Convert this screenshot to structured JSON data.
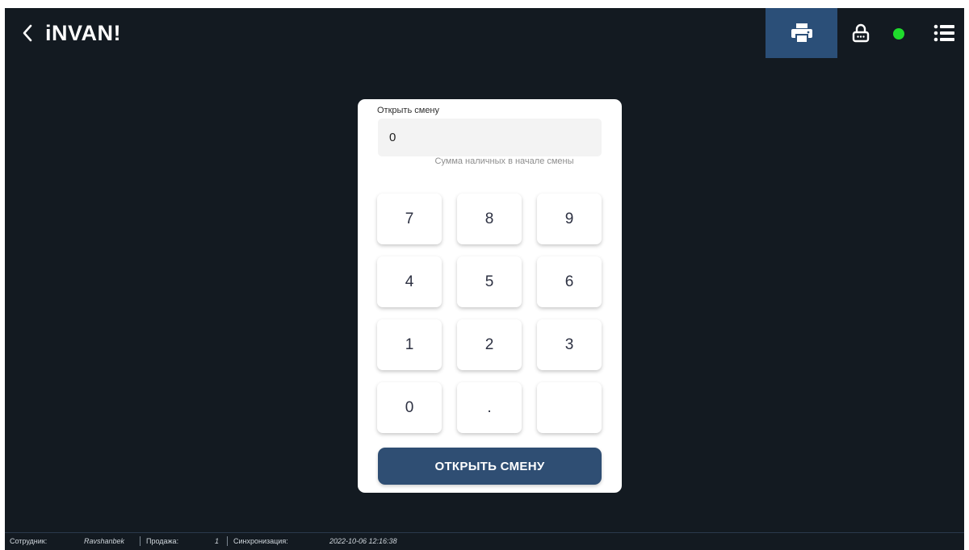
{
  "header": {
    "logo": "iNVAN!",
    "status_color": "#1fdc2c",
    "icons": [
      "chevron-left-icon",
      "printer-icon",
      "lock-icon",
      "menu-list-icon"
    ]
  },
  "form": {
    "title": "Открыть смену",
    "amount_value": "0",
    "hint": "Сумма наличных в начале смены",
    "keys": [
      "7",
      "8",
      "9",
      "4",
      "5",
      "6",
      "1",
      "2",
      "3",
      "0",
      ".",
      ""
    ],
    "submit_label": "ОТКРЫТЬ СМЕНУ"
  },
  "statusbar": {
    "employee_label": "Сотрудник:",
    "employee_value": "Ravshanbek",
    "sale_label": "Продажа:",
    "sale_value": "1",
    "sync_label": "Синхронизация:",
    "sync_value": "2022-10-06 12:16:38"
  },
  "colors": {
    "background": "#131a21",
    "accent": "#2f4e73",
    "online": "#1fdc2c"
  }
}
